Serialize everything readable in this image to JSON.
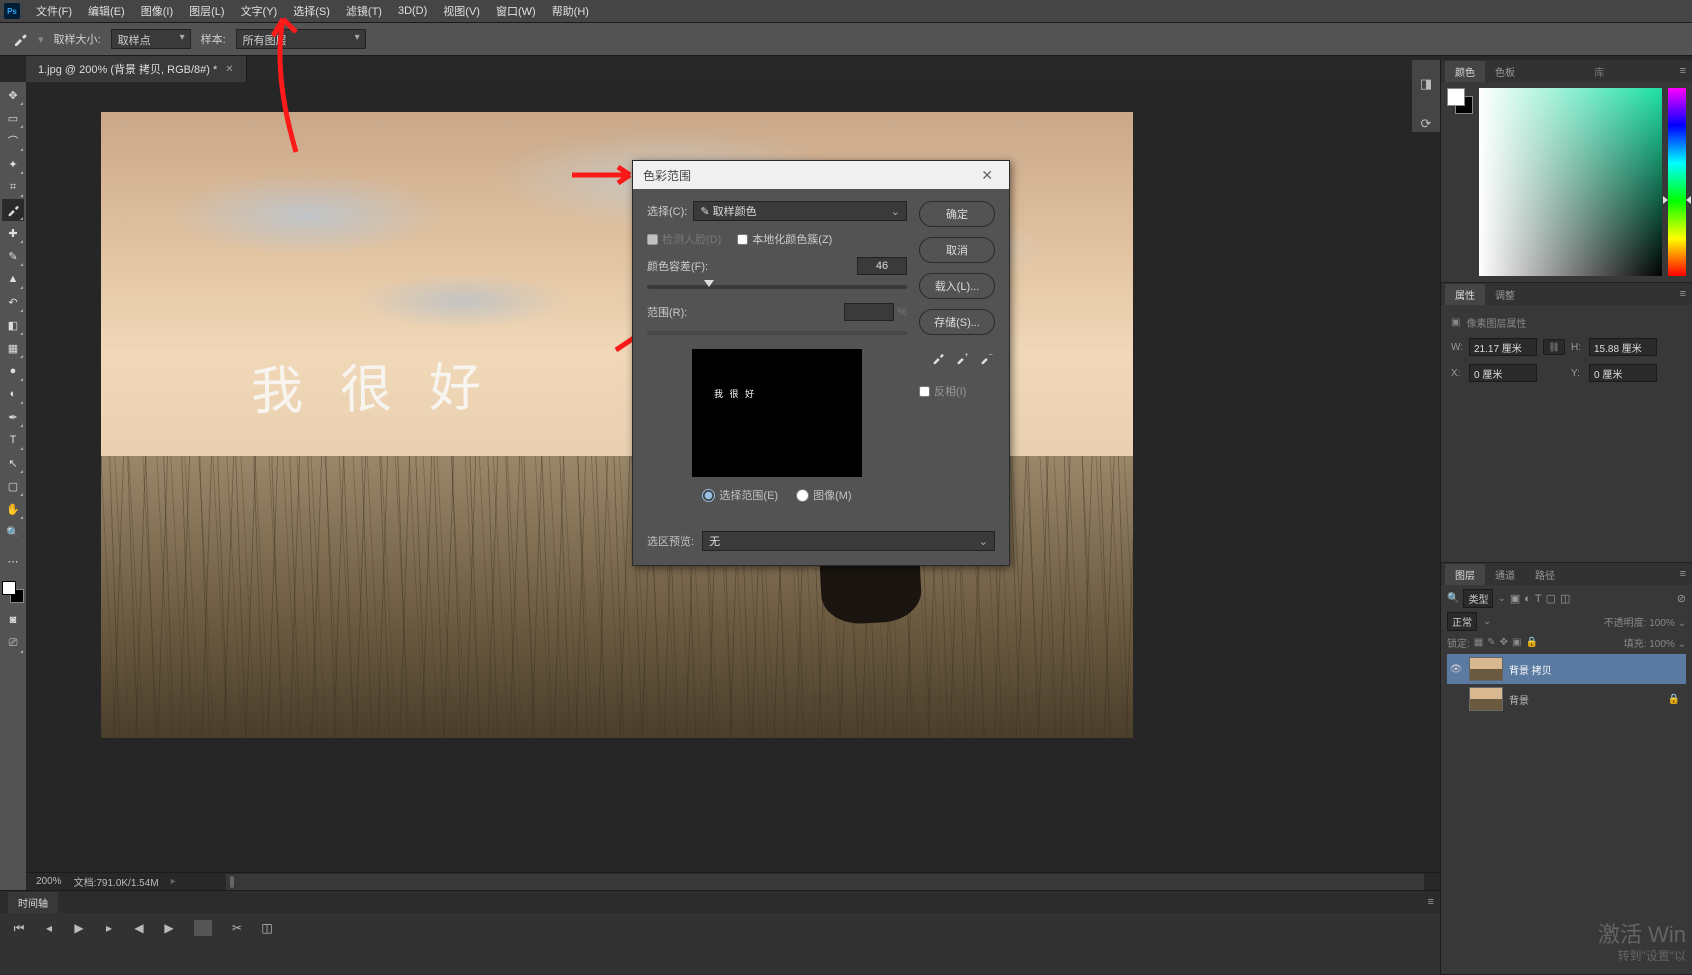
{
  "menubar": {
    "items": [
      "文件(F)",
      "编辑(E)",
      "图像(I)",
      "图层(L)",
      "文字(Y)",
      "选择(S)",
      "滤镜(T)",
      "3D(D)",
      "视图(V)",
      "窗口(W)",
      "帮助(H)"
    ]
  },
  "options": {
    "sample_size_label": "取样大小:",
    "sample_size_value": "取样点",
    "sample_label": "样本:",
    "sample_value": "所有图层"
  },
  "doc_tab": {
    "title": "1.jpg @ 200% (背景 拷贝, RGB/8#) *"
  },
  "canvas": {
    "handwriting": "我 很 好"
  },
  "status": {
    "zoom": "200%",
    "doc_info": "文档:791.0K/1.54M"
  },
  "dialog": {
    "title": "色彩范围",
    "select_label": "选择(C):",
    "select_value": "✎ 取样颜色",
    "detect_faces": "检测人脸(D)",
    "localized": "本地化颜色簇(Z)",
    "fuzziness_label": "颜色容差(F):",
    "fuzziness_value": "46",
    "range_label": "范围(R):",
    "range_unit": "%",
    "radio_selection": "选择范围(E)",
    "radio_image": "图像(M)",
    "preview_label": "选区预览:",
    "preview_value": "无",
    "btn_ok": "确定",
    "btn_cancel": "取消",
    "btn_load": "载入(L)...",
    "btn_save": "存储(S)...",
    "invert": "反相(I)",
    "preview_text": "我 很 好"
  },
  "panels": {
    "color_tab": "颜色",
    "swatches_tab": "色板",
    "lib_tab": "库",
    "props_tab": "属性",
    "adjust_tab": "调整",
    "props_title": "像素图层属性",
    "props_w_label": "W:",
    "props_w": "21.17 厘米",
    "props_h_label": "H:",
    "props_h": "15.88 厘米",
    "props_x_label": "X:",
    "props_x": "0 厘米",
    "props_y_label": "Y:",
    "props_y": "0 厘米",
    "layers_tab": "图层",
    "channels_tab": "通道",
    "paths_tab": "路径",
    "kind_label": "类型",
    "blend_mode": "正常",
    "opacity_label": "不透明度:",
    "opacity_value": "100%",
    "lock_label": "锁定:",
    "fill_label": "填充:",
    "fill_value": "100%",
    "layer1": "背景 拷贝",
    "layer2": "背景"
  },
  "timeline": {
    "tab": "时间轴"
  },
  "watermark": {
    "line1": "激活 Win",
    "line2": "转到\"设置\"以"
  }
}
